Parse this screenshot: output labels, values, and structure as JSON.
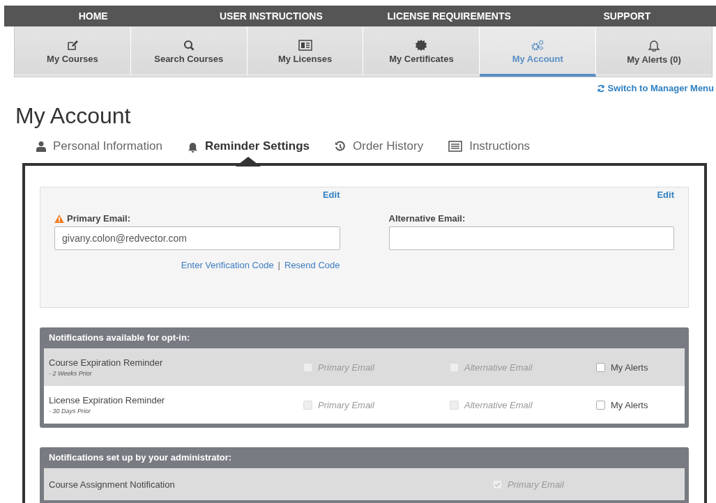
{
  "top_nav": [
    "HOME",
    "USER INSTRUCTIONS",
    "LICENSE REQUIREMENTS",
    "SUPPORT"
  ],
  "main_tabs": [
    {
      "label": "My Courses",
      "selected": false
    },
    {
      "label": "Search Courses",
      "selected": false
    },
    {
      "label": "My Licenses",
      "selected": false
    },
    {
      "label": "My Certificates",
      "selected": false
    },
    {
      "label": "My Account",
      "selected": true
    },
    {
      "label": "My Alerts (0)",
      "selected": false
    }
  ],
  "switch_link": "Switch to Manager Menu",
  "page_title": "My Account",
  "sub_tabs": [
    {
      "label": "Personal Information",
      "selected": false
    },
    {
      "label": "Reminder Settings",
      "selected": true
    },
    {
      "label": "Order History",
      "selected": false
    },
    {
      "label": "Instructions",
      "selected": false
    }
  ],
  "email_panel": {
    "columns": [
      {
        "edit": "Edit",
        "label": "Primary Email:",
        "warning": true,
        "value": "givany.colon@redvector.com",
        "links": [
          "Enter Verification Code",
          "|",
          "Resend Code"
        ]
      },
      {
        "edit": "Edit",
        "label": "Alternative Email:",
        "warning": false
      }
    ]
  },
  "opt_in": {
    "title": "Notifications available for opt-in:",
    "rows": [
      {
        "name": "Course Expiration Reminder",
        "detail": "- 2 Weeks Prior",
        "options": [
          {
            "label": "Primary Email",
            "checked": false,
            "disabled": true
          },
          {
            "label": "Alternative Email",
            "checked": false,
            "disabled": true
          },
          {
            "label": "My Alerts",
            "checked": false,
            "disabled": false
          }
        ]
      },
      {
        "name": "License Expiration Reminder",
        "detail": "- 30 Days Prior",
        "options": [
          {
            "label": "Primary Email",
            "checked": false,
            "disabled": true
          },
          {
            "label": "Alternative Email",
            "checked": false,
            "disabled": true
          },
          {
            "label": "My Alerts",
            "checked": false,
            "disabled": false
          }
        ]
      }
    ]
  },
  "admin": {
    "title": "Notifications set up by your administrator:",
    "rows": [
      {
        "name": "Course Assignment Notification",
        "options": [
          {
            "label": "Primary Email",
            "checked": true,
            "disabled": true
          }
        ]
      }
    ]
  }
}
